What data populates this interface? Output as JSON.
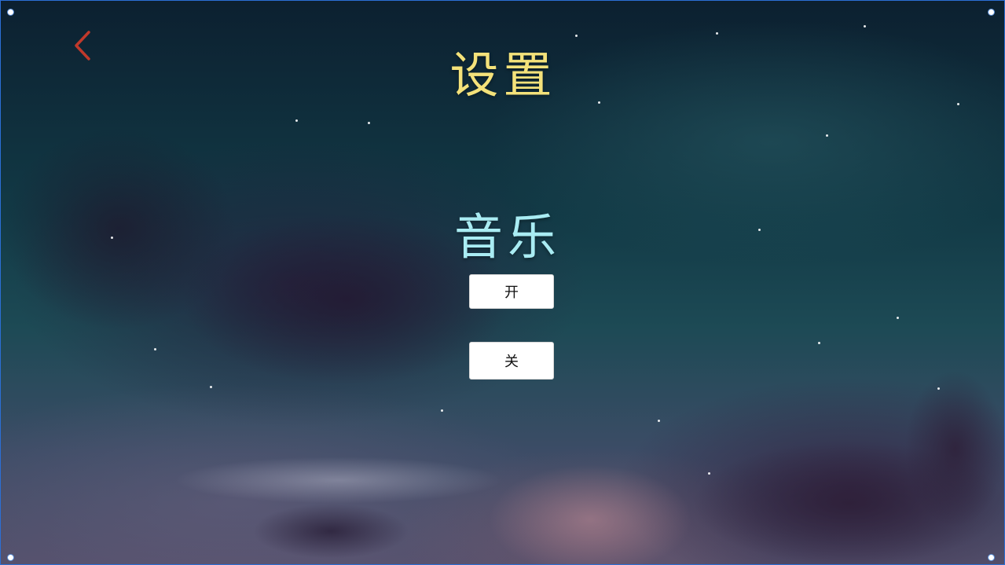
{
  "header": {
    "title": "设置",
    "back_icon": "chevron-left-icon"
  },
  "music": {
    "label": "音乐",
    "on_label": "开",
    "off_label": "关"
  },
  "colors": {
    "title": "#f4e27a",
    "section_label": "#a9ecf3",
    "back_icon": "#c0392b",
    "button_bg": "#ffffff"
  }
}
